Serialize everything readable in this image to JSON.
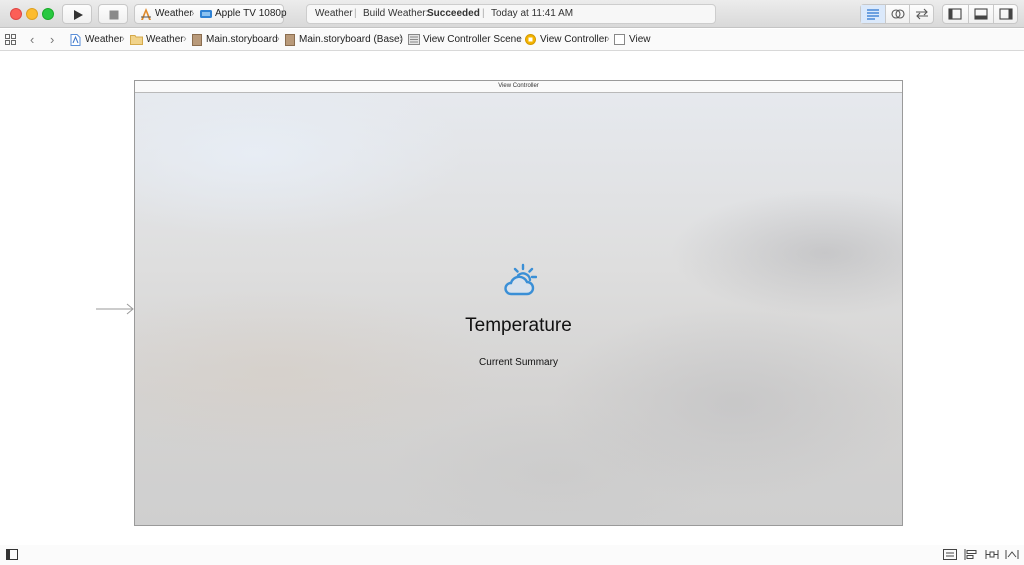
{
  "toolbar": {
    "scheme": {
      "target": "Weather",
      "device": "Apple TV 1080p"
    },
    "activity": {
      "project": "Weather",
      "status_prefix": "Build Weather:",
      "status_result": "Succeeded",
      "timestamp": "Today at 11:41 AM"
    },
    "icons": [
      "run-icon",
      "stop-icon",
      "standard-editor-icon",
      "assistant-editor-icon",
      "version-editor-icon",
      "navigator-toggle-icon",
      "debug-area-toggle-icon",
      "utilities-toggle-icon"
    ]
  },
  "jumpbar": {
    "items": [
      {
        "label": "Weather",
        "icon": "project-file-icon"
      },
      {
        "label": "Weather",
        "icon": "folder-icon"
      },
      {
        "label": "Main.storyboard",
        "icon": "storyboard-icon"
      },
      {
        "label": "Main.storyboard (Base)",
        "icon": "storyboard-icon"
      },
      {
        "label": "View Controller Scene",
        "icon": "scene-icon"
      },
      {
        "label": "View Controller",
        "icon": "view-controller-icon"
      },
      {
        "label": "View",
        "icon": "view-icon"
      }
    ]
  },
  "canvas": {
    "scene_title": "View Controller",
    "temperature_label": "Temperature",
    "summary_label": "Current Summary",
    "accent_color": "#3a8fd6"
  }
}
